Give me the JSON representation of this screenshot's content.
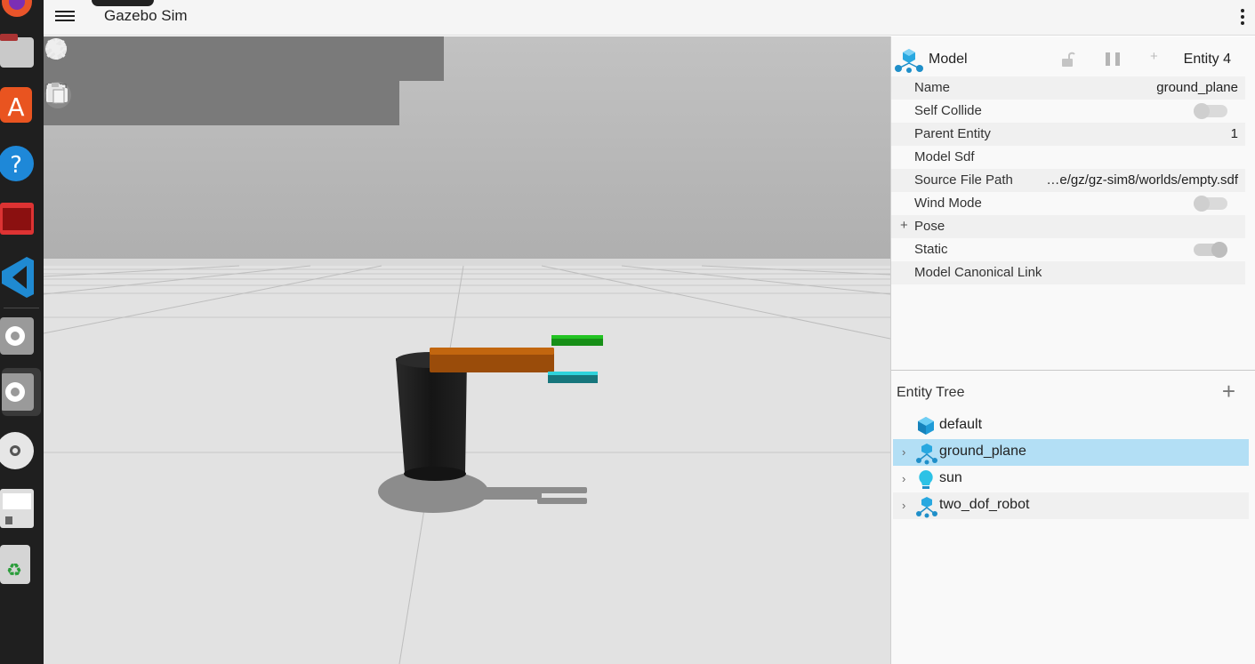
{
  "window": {
    "title": "Gazebo Sim"
  },
  "toolbar": {
    "shapes": [
      "box-icon",
      "sphere-icon",
      "cone-icon",
      "cylinder-icon",
      "capsule-icon",
      "ellipsoid-icon",
      "point-light-icon",
      "directional-light-icon",
      "spot-light-icon"
    ],
    "tools": [
      "select-icon",
      "translate-icon",
      "rotate-icon",
      "transform-control-icon",
      "grid-snap-icon",
      "screenshot-icon",
      "copy-icon",
      "paste-icon"
    ]
  },
  "component_inspector": {
    "title": "Model",
    "entity_label": "Entity 4",
    "rows": [
      {
        "label": "Name",
        "value": "ground_plane"
      },
      {
        "label": "Self Collide",
        "value": ""
      },
      {
        "label": "Parent Entity",
        "value": "1"
      },
      {
        "label": "Model Sdf",
        "value": ""
      },
      {
        "label": "Source File Path",
        "value": "…e/gz/gz-sim8/worlds/empty.sdf"
      },
      {
        "label": "Wind Mode",
        "value": ""
      },
      {
        "label": "Pose",
        "value": ""
      },
      {
        "label": "Static",
        "value": ""
      },
      {
        "label": "Model Canonical Link",
        "value": ""
      }
    ],
    "toggles": {
      "self_collide": false,
      "wind_mode": false,
      "static": true
    }
  },
  "entity_tree": {
    "title": "Entity Tree",
    "add_label": "+",
    "items": [
      {
        "label": "default",
        "icon": "world-cube-icon",
        "expandable": false,
        "selected": false
      },
      {
        "label": "ground_plane",
        "icon": "model-icon",
        "expandable": true,
        "selected": true
      },
      {
        "label": "sun",
        "icon": "light-bulb-icon",
        "expandable": true,
        "selected": false
      },
      {
        "label": "two_dof_robot",
        "icon": "model-icon",
        "expandable": true,
        "selected": false
      }
    ]
  },
  "colors": {
    "selected_row": "#b3dff5",
    "robot_base": "#1a1a1a",
    "robot_arm": "#b35a0c",
    "gripper_top": "#1aa31a",
    "gripper_bottom": "#1b8f96"
  },
  "dock": [
    "firefox-icon",
    "files-icon",
    "app-center-icon",
    "help-icon",
    "terminal-icon",
    "vscode-icon",
    "settings-icon",
    "settings-active-icon",
    "disc-icon",
    "save-icon",
    "trash-icon"
  ]
}
